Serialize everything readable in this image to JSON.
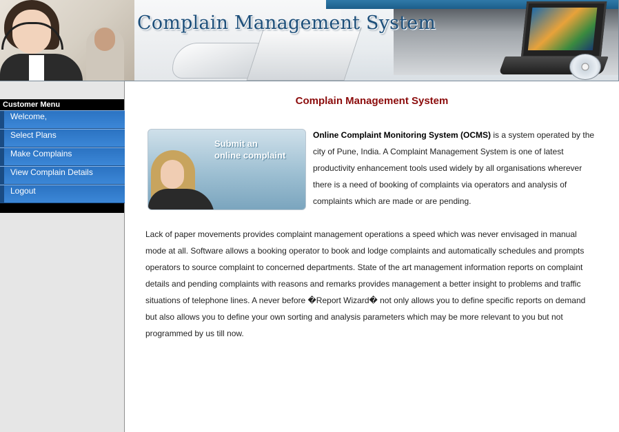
{
  "banner": {
    "title": "Complain Management System"
  },
  "sidebar": {
    "header": "Customer Menu",
    "items": [
      {
        "label": "Welcome,"
      },
      {
        "label": "Select Plans"
      },
      {
        "label": "Make Complains"
      },
      {
        "label": "View Complain Details"
      },
      {
        "label": "Logout"
      }
    ]
  },
  "main": {
    "title": "Complain Management System",
    "promo_image": {
      "line1": "Submit an",
      "line2": "online complaint"
    },
    "intro_bold": "Online Complaint Monitoring System (OCMS)",
    "intro_rest": " is a system operated by the city of Pune, India. A Complaint Management System is one of latest productivity enhancement tools used widely by all organisations wherever there is a need of booking of complaints via operators and analysis of complaints which are made or are pending.",
    "body": "Lack of paper movements provides complaint management operations a speed which was never envisaged in manual mode at all. Software allows a booking operator to book and lodge complaints and automatically schedules and prompts operators to source complaint to concerned departments. State of the art management information reports on complaint details and pending complaints with reasons and remarks provides management a better insight to problems and traffic situations of telephone lines. A never before �Report Wizard� not only allows you to define specific reports on demand but also allows you to define your own sorting and analysis parameters which may be more relevant to you but not programmed by us till now."
  },
  "colors": {
    "menu_blue": "#2b73c2",
    "title_red": "#8b0b0b",
    "banner_title_blue": "#1d4f7a"
  }
}
